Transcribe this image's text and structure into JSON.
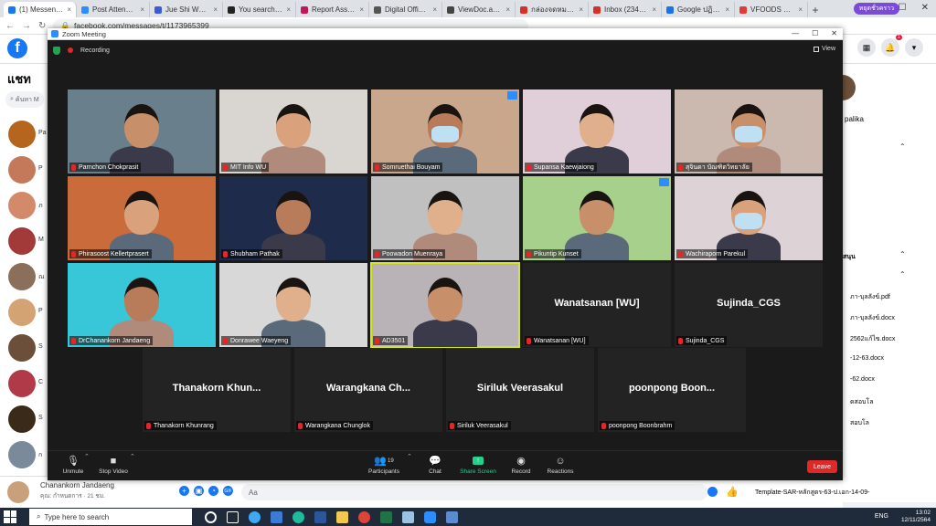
{
  "browser": {
    "tabs": [
      {
        "title": "(1) Messenger |",
        "color": "#1877f2",
        "active": true
      },
      {
        "title": "Post Attendee",
        "color": "#2d8cff",
        "active": false
      },
      {
        "title": "Jue Shi Wu Hun",
        "color": "#3b5bdb",
        "active": false
      },
      {
        "title": "You searched fo",
        "color": "#222222",
        "active": false
      },
      {
        "title": "Report Asset :: A",
        "color": "#c2185b",
        "active": false
      },
      {
        "title": "Digital Office M",
        "color": "#555555",
        "active": false
      },
      {
        "title": "ViewDoc.aspx",
        "color": "#444444",
        "active": false
      },
      {
        "title": "กล่องจดหมาย (24",
        "color": "#d93025",
        "active": false
      },
      {
        "title": "Inbox (234) - ecr",
        "color": "#d93025",
        "active": false
      },
      {
        "title": "Google ปฏิทิน - ส",
        "color": "#1a73e8",
        "active": false
      },
      {
        "title": "VFOODS Offici",
        "color": "#e53935",
        "active": false
      }
    ],
    "url": "facebook.com/messages/t/1173965399",
    "profile_label": "หยุดชั่วคราว"
  },
  "facebook": {
    "chat_title": "แชท",
    "search_placeholder": "ค้นหา M",
    "notification_count": "1",
    "chat_list": [
      {
        "initial": "Pa",
        "color": "#b5651d"
      },
      {
        "initial": "P",
        "color": "#c47a5a"
      },
      {
        "initial": "ภ",
        "color": "#d28a6a"
      },
      {
        "initial": "M",
        "color": "#a33a3a"
      },
      {
        "initial": "ณ",
        "color": "#8a6f5a"
      },
      {
        "initial": "P",
        "color": "#d4a373"
      },
      {
        "initial": "S",
        "color": "#6b4f3a"
      },
      {
        "initial": "C",
        "color": "#b03a48"
      },
      {
        "initial": "S",
        "color": "#3a2a1a"
      },
      {
        "initial": "ก",
        "color": "#7a8a9a"
      }
    ],
    "right_panel": {
      "name": "palika",
      "section": "สนุน",
      "files": [
        "ภา-บุลลังข์.pdf",
        "ภา-บุลลังข์.docx",
        "2562แก้ไข.docx",
        "-12-63.docx",
        "-62.docx",
        "ดสอบโล",
        "สอบโล"
      ]
    },
    "bottom": {
      "name": "Chanankorn Jandaeng",
      "subtitle": "คุณ: กำหนดการ · 21 ชม.",
      "message_placeholder": "Aa",
      "file_name": "Template-SAR-หลักสูตร-63-ป.เอก-14-09-"
    }
  },
  "zoom": {
    "window_title": "Zoom Meeting",
    "recording_label": "Recording",
    "view_label": "View",
    "participants": [
      {
        "name": "Parnchon Chokprasit",
        "kind": "video",
        "bg": "#6a7f8c"
      },
      {
        "name": "MIT Info WU",
        "kind": "video",
        "bg": "#d9d6d1"
      },
      {
        "name": "Somruethai Bouyam",
        "kind": "video",
        "bg": "#c9a78c"
      },
      {
        "name": "Supansa Kaewjaiong",
        "kind": "video",
        "bg": "#e0cfd8"
      },
      {
        "name": "สุจินดา บัณฑิตวิทยาลัย",
        "kind": "video",
        "bg": "#cbb9b0"
      },
      {
        "name": "Phirasoost Kellertprasert",
        "kind": "video",
        "bg": "#c96b3a"
      },
      {
        "name": "Shubham Pathak",
        "kind": "video",
        "bg": "#1e2b4a"
      },
      {
        "name": "Poowadon Muenraya",
        "kind": "video",
        "bg": "#c0c0c0"
      },
      {
        "name": "Pikuntip Kunset",
        "kind": "video",
        "bg": "#a8d08d"
      },
      {
        "name": "Wachiraporn Parekul",
        "kind": "video",
        "bg": "#ddd3d6"
      },
      {
        "name": "DrChanankorn Jandaeng",
        "kind": "video",
        "bg": "#38c7d8"
      },
      {
        "name": "Donrawee Waeyeng",
        "kind": "video",
        "bg": "#d8d8d8"
      },
      {
        "name": "AD3501",
        "kind": "video",
        "bg": "#b9b2b6"
      },
      {
        "name": "Wanatsanan [WU]",
        "kind": "name",
        "display": "Wanatsanan [WU]",
        "bg": "#232323"
      },
      {
        "name": "Sujinda_CGS",
        "kind": "name",
        "display": "Sujinda_CGS",
        "bg": "#232323"
      },
      {
        "name": "Thanakorn Khunrang",
        "kind": "name",
        "display": "Thanakorn  Khun...",
        "bg": "#232323"
      },
      {
        "name": "Warangkana Chunglok",
        "kind": "name",
        "display": "Warangkana  Ch...",
        "bg": "#232323"
      },
      {
        "name": "Siriluk Veerasakul",
        "kind": "name",
        "display": "Siriluk Veerasakul",
        "bg": "#232323"
      },
      {
        "name": "poonpong Boonbrahm",
        "kind": "name",
        "display": "poonpong  Boon...",
        "bg": "#232323"
      }
    ],
    "toolbar": {
      "unmute": "Unmute",
      "stop_video": "Stop Video",
      "participants": "Participants",
      "participant_count": "19",
      "chat": "Chat",
      "share_screen": "Share Screen",
      "record": "Record",
      "reactions": "Reactions",
      "leave": "Leave"
    }
  },
  "taskbar": {
    "search_placeholder": "Type here to search",
    "language": "ENG",
    "time": "13:02",
    "date": "12/11/2564"
  }
}
